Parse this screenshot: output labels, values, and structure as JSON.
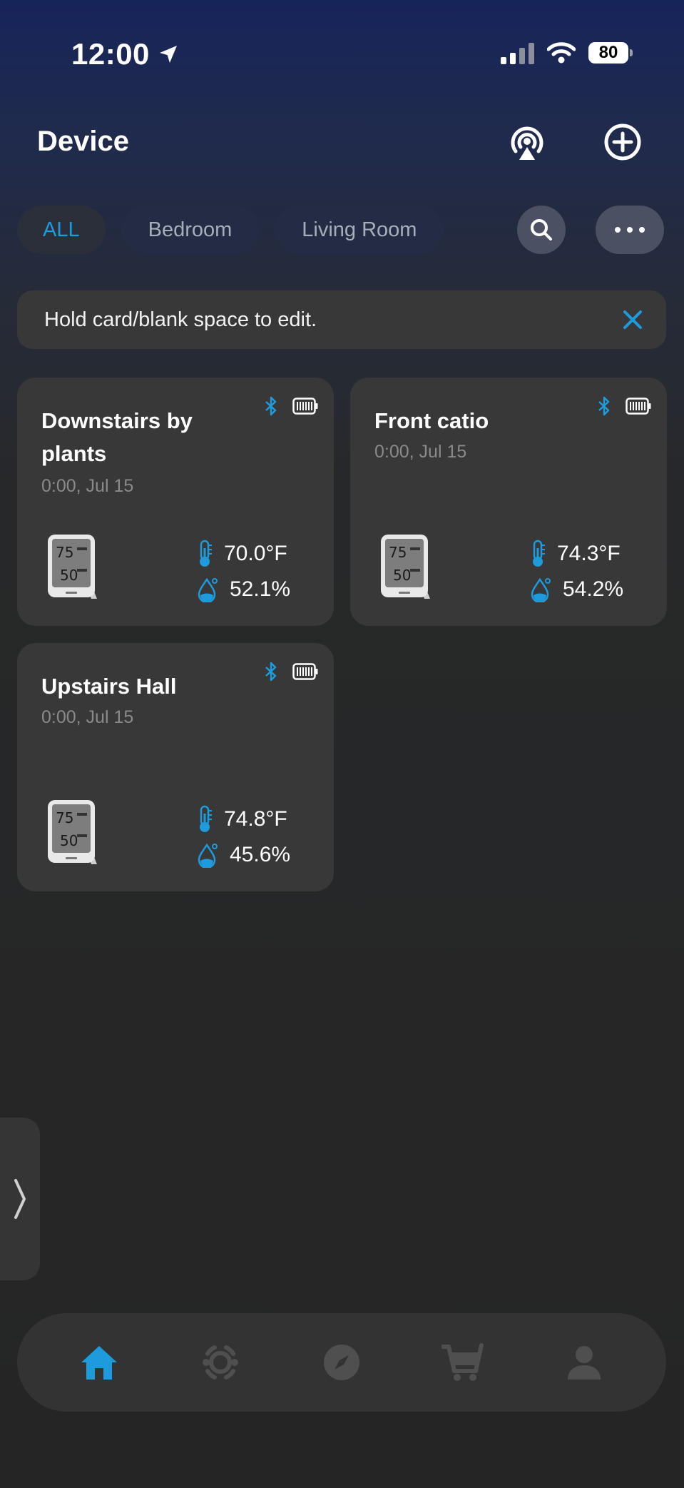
{
  "status_bar": {
    "time": "12:00",
    "battery": "80"
  },
  "header": {
    "title": "Device"
  },
  "filter_tabs": [
    {
      "label": "ALL",
      "active": true
    },
    {
      "label": "Bedroom",
      "active": false
    },
    {
      "label": "Living Room",
      "active": false
    }
  ],
  "hint": {
    "text": "Hold card/blank space to edit."
  },
  "devices": [
    {
      "name": "Downstairs by plants",
      "time": "0:00,  Jul 15",
      "temperature": "70.0°F",
      "humidity": "52.1%"
    },
    {
      "name": "Front catio",
      "time": "0:00,  Jul 15",
      "temperature": "74.3°F",
      "humidity": "54.2%"
    },
    {
      "name": "Upstairs Hall",
      "time": "0:00,  Jul 15",
      "temperature": "74.8°F",
      "humidity": "45.6%"
    }
  ],
  "bottom_nav": [
    {
      "icon": "home-icon",
      "active": true
    },
    {
      "icon": "scene-icon",
      "active": false
    },
    {
      "icon": "compass-icon",
      "active": false
    },
    {
      "icon": "cart-icon",
      "active": false
    },
    {
      "icon": "profile-icon",
      "active": false
    }
  ],
  "colors": {
    "accent": "#1d9bdc",
    "card": "#383838",
    "inactive_icon": "#4f4f4f"
  },
  "device_thumb": {
    "display_top": "75",
    "display_bottom": "50"
  }
}
